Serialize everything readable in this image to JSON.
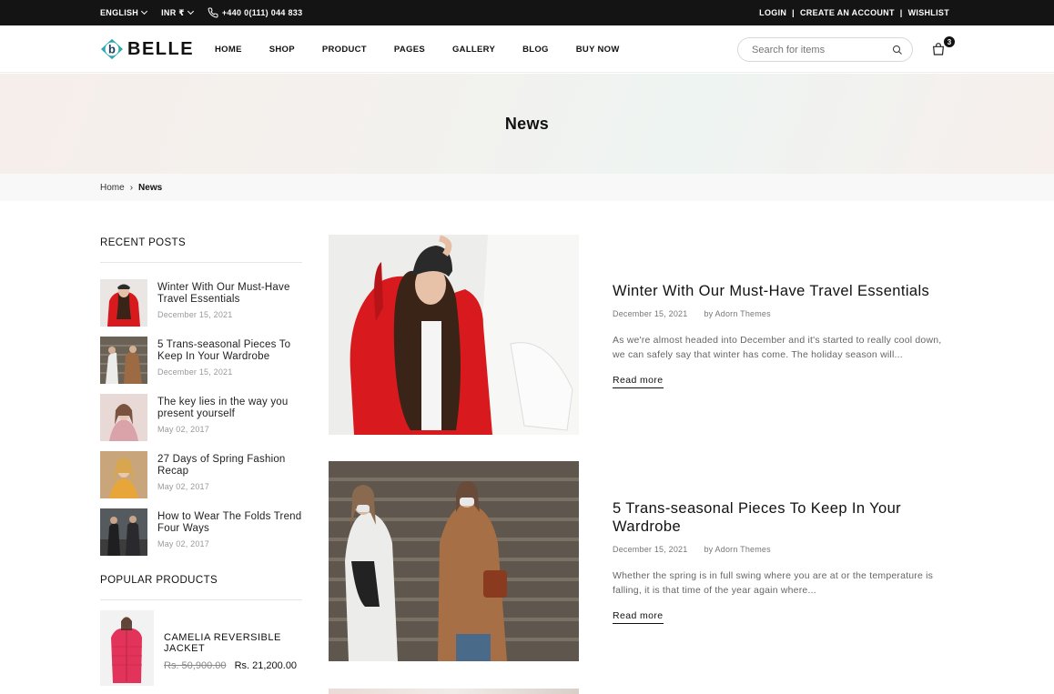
{
  "topbar": {
    "language": "ENGLISH",
    "currency": "INR ₹",
    "phone": "+440 0(111) 044 833",
    "login": "LOGIN",
    "create_account": "CREATE AN ACCOUNT",
    "wishlist": "WISHLIST",
    "separator": "|"
  },
  "header": {
    "logo_text": "BELLE",
    "logo_letter": "b",
    "nav": [
      "HOME",
      "SHOP",
      "PRODUCT",
      "PAGES",
      "GALLERY",
      "BLOG",
      "BUY NOW"
    ],
    "search_placeholder": "Search for items",
    "cart_count": "3"
  },
  "banner": {
    "title": "News"
  },
  "breadcrumb": {
    "home": "Home",
    "separator": "›",
    "current": "News"
  },
  "sidebar": {
    "recent_title": "RECENT POSTS",
    "recent_posts": [
      {
        "title": "Winter With Our Must-Have Travel Essentials",
        "date": "December 15, 2021"
      },
      {
        "title": "5 Trans-seasonal Pieces To Keep In Your Wardrobe",
        "date": "December 15, 2021"
      },
      {
        "title": "The key lies in the way you present yourself",
        "date": "May 02, 2017"
      },
      {
        "title": "27 Days of Spring Fashion Recap",
        "date": "May 02, 2017"
      },
      {
        "title": "How to Wear The Folds Trend Four Ways",
        "date": "May 02, 2017"
      }
    ],
    "popular_title": "POPULAR PRODUCTS",
    "product": {
      "name": "CAMELIA REVERSIBLE JACKET",
      "old_price": "Rs. 50,900.00",
      "price": "Rs. 21,200.00"
    }
  },
  "articles": [
    {
      "title": "Winter With Our Must-Have Travel Essentials",
      "date": "December 15, 2021",
      "author": "by Adorn Themes",
      "excerpt": "As we're almost headed into December and it's started to really cool down, we can safely say that winter has come. The holiday season will...",
      "read_more": "Read more"
    },
    {
      "title": "5 Trans-seasonal Pieces To Keep In Your Wardrobe",
      "date": "December 15, 2021",
      "author": "by Adorn Themes",
      "excerpt": "Whether the spring is in full swing where you are at or the temperature is falling, it is that time of the year again where...",
      "read_more": "Read more"
    }
  ],
  "colors": {
    "topbar_bg": "#141414",
    "logo_teal": "#2aa7b0",
    "logo_dark": "#1c3d5a",
    "coat_red": "#d8191e"
  }
}
